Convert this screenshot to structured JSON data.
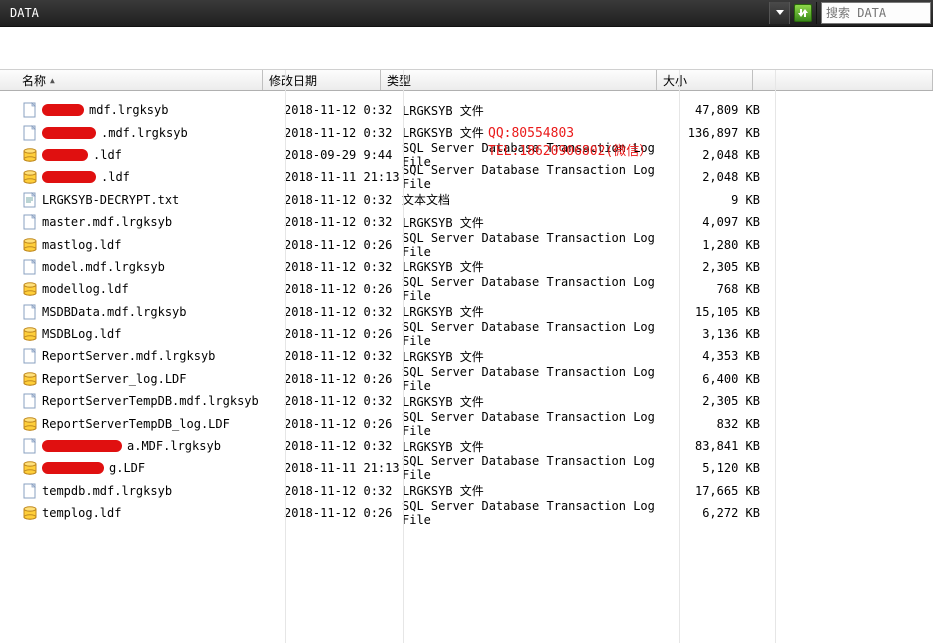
{
  "toolbar": {
    "path": "DATA",
    "search_placeholder": "搜索 DATA"
  },
  "columns": {
    "name": "名称",
    "date": "修改日期",
    "type": "类型",
    "size": "大小"
  },
  "watermark": {
    "line1": "QQ:80554803",
    "line2": "TEL:18620906802(微信）"
  },
  "files": [
    {
      "icon": "page",
      "redact_w": 42,
      "name_suffix": "mdf.lrgksyb",
      "date": "2018-11-12 0:32",
      "type": "LRGKSYB 文件",
      "size": "47,809 KB"
    },
    {
      "icon": "page",
      "redact_w": 54,
      "name_suffix": ".mdf.lrgksyb",
      "date": "2018-11-12 0:32",
      "type": "LRGKSYB 文件",
      "size": "136,897 KB"
    },
    {
      "icon": "db",
      "redact_w": 46,
      "name_suffix": ".ldf",
      "date": "2018-09-29 9:44",
      "type": "SQL Server Database Transaction Log File",
      "size": "2,048 KB"
    },
    {
      "icon": "db",
      "redact_w": 54,
      "name_suffix": ".ldf",
      "date": "2018-11-11 21:13",
      "type": "SQL Server Database Transaction Log File",
      "size": "2,048 KB"
    },
    {
      "icon": "txt",
      "redact_w": 0,
      "name_suffix": "LRGKSYB-DECRYPT.txt",
      "date": "2018-11-12 0:32",
      "type": "文本文档",
      "size": "9 KB"
    },
    {
      "icon": "page",
      "redact_w": 0,
      "name_suffix": "master.mdf.lrgksyb",
      "date": "2018-11-12 0:32",
      "type": "LRGKSYB 文件",
      "size": "4,097 KB"
    },
    {
      "icon": "db",
      "redact_w": 0,
      "name_suffix": "mastlog.ldf",
      "date": "2018-11-12 0:26",
      "type": "SQL Server Database Transaction Log File",
      "size": "1,280 KB"
    },
    {
      "icon": "page",
      "redact_w": 0,
      "name_suffix": "model.mdf.lrgksyb",
      "date": "2018-11-12 0:32",
      "type": "LRGKSYB 文件",
      "size": "2,305 KB"
    },
    {
      "icon": "db",
      "redact_w": 0,
      "name_suffix": "modellog.ldf",
      "date": "2018-11-12 0:26",
      "type": "SQL Server Database Transaction Log File",
      "size": "768 KB"
    },
    {
      "icon": "page",
      "redact_w": 0,
      "name_suffix": "MSDBData.mdf.lrgksyb",
      "date": "2018-11-12 0:32",
      "type": "LRGKSYB 文件",
      "size": "15,105 KB"
    },
    {
      "icon": "db",
      "redact_w": 0,
      "name_suffix": "MSDBLog.ldf",
      "date": "2018-11-12 0:26",
      "type": "SQL Server Database Transaction Log File",
      "size": "3,136 KB"
    },
    {
      "icon": "page",
      "redact_w": 0,
      "name_suffix": "ReportServer.mdf.lrgksyb",
      "date": "2018-11-12 0:32",
      "type": "LRGKSYB 文件",
      "size": "4,353 KB"
    },
    {
      "icon": "db",
      "redact_w": 0,
      "name_suffix": "ReportServer_log.LDF",
      "date": "2018-11-12 0:26",
      "type": "SQL Server Database Transaction Log File",
      "size": "6,400 KB"
    },
    {
      "icon": "page",
      "redact_w": 0,
      "name_suffix": "ReportServerTempDB.mdf.lrgksyb",
      "date": "2018-11-12 0:32",
      "type": "LRGKSYB 文件",
      "size": "2,305 KB"
    },
    {
      "icon": "db",
      "redact_w": 0,
      "name_suffix": "ReportServerTempDB_log.LDF",
      "date": "2018-11-12 0:26",
      "type": "SQL Server Database Transaction Log File",
      "size": "832 KB"
    },
    {
      "icon": "page",
      "redact_w": 80,
      "name_suffix": "a.MDF.lrgksyb",
      "date": "2018-11-12 0:32",
      "type": "LRGKSYB 文件",
      "size": "83,841 KB"
    },
    {
      "icon": "db",
      "redact_w": 62,
      "name_suffix": "g.LDF",
      "date": "2018-11-11 21:13",
      "type": "SQL Server Database Transaction Log File",
      "size": "5,120 KB"
    },
    {
      "icon": "page",
      "redact_w": 0,
      "name_suffix": "tempdb.mdf.lrgksyb",
      "date": "2018-11-12 0:32",
      "type": "LRGKSYB 文件",
      "size": "17,665 KB"
    },
    {
      "icon": "db",
      "redact_w": 0,
      "name_suffix": "templog.ldf",
      "date": "2018-11-12 0:26",
      "type": "SQL Server Database Transaction Log File",
      "size": "6,272 KB"
    }
  ]
}
